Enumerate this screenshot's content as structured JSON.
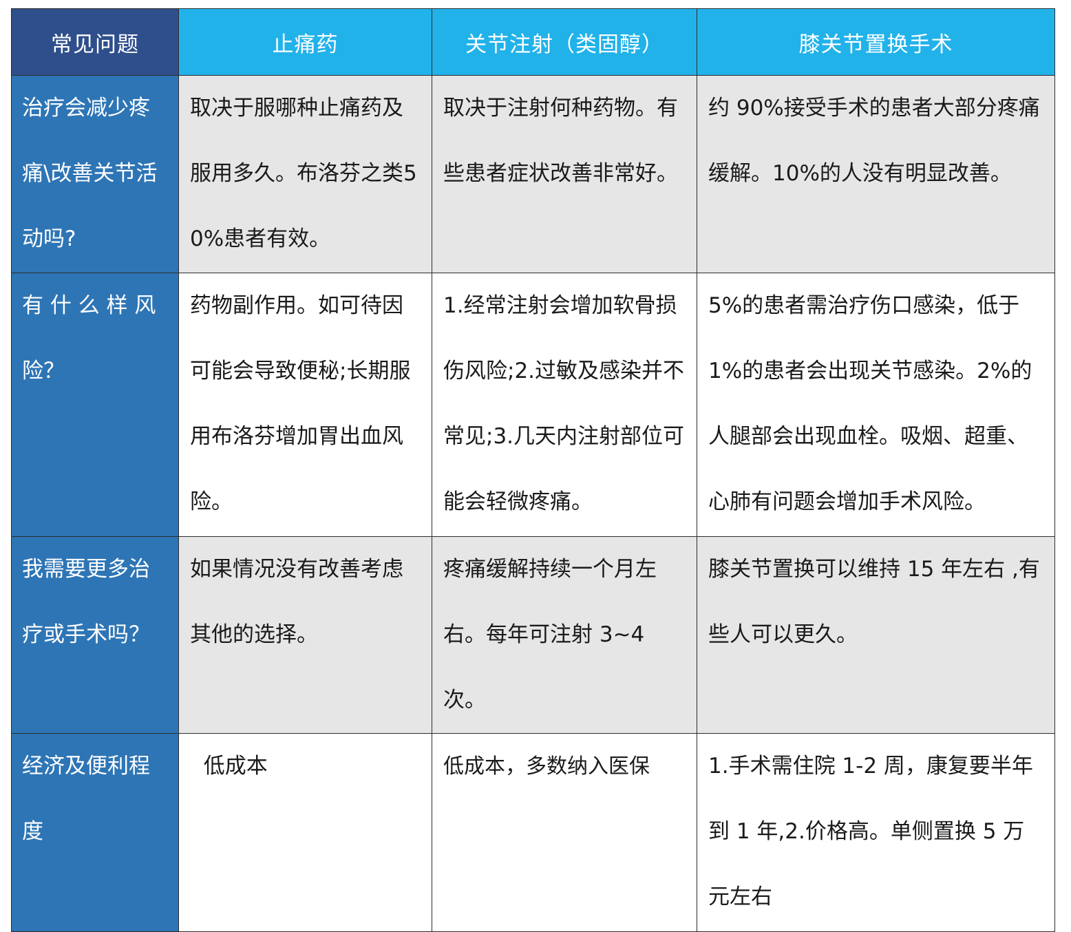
{
  "table": {
    "headers": [
      "常见问题",
      "止痛药",
      "关节注射（类固醇）",
      "膝关节置换手术"
    ],
    "rows": [
      {
        "question": "治疗会减少疼痛\\改善关节活动吗?",
        "cells": [
          "取决于服哪种止痛药及服用多久。布洛芬之类50%患者有效。",
          "取决于注射何种药物。有些患者症状改善非常好。",
          "约 90%接受手术的患者大部分疼痛缓解。10%的人没有明显改善。"
        ]
      },
      {
        "question": "有 什 么 样 风 险？",
        "cells": [
          "药物副作用。如可待因可能会导致便秘;长期服用布洛芬增加胃出血风险。",
          "1.经常注射会增加软骨损伤风险;2.过敏及感染并不常见;3.几天内注射部位可能会轻微疼痛。",
          "5%的患者需治疗伤口感染，低于1%的患者会出现关节感染。2%的人腿部会出现血栓。吸烟、超重、心肺有问题会增加手术风险。"
        ]
      },
      {
        "question": "我需要更多治疗或手术吗？",
        "cells": [
          "如果情况没有改善考虑其他的选择。",
          "疼痛缓解持续一个月左右。每年可注射 3~4 次。",
          "膝关节置换可以维持 15 年左右 ,有些人可以更久。"
        ]
      },
      {
        "question": "经济及便利程度",
        "cells": [
          "  低成本",
          "低成本，多数纳入医保",
          "1.手术需住院 1-2 周，康复要半年到 1 年,2.价格高。单侧置换 5 万元左右"
        ]
      }
    ]
  },
  "colors": {
    "header_dark": "#2f4f8c",
    "header_light": "#22b2ea",
    "question_column": "#2e75b5",
    "shaded_row": "#e6e6e6"
  }
}
